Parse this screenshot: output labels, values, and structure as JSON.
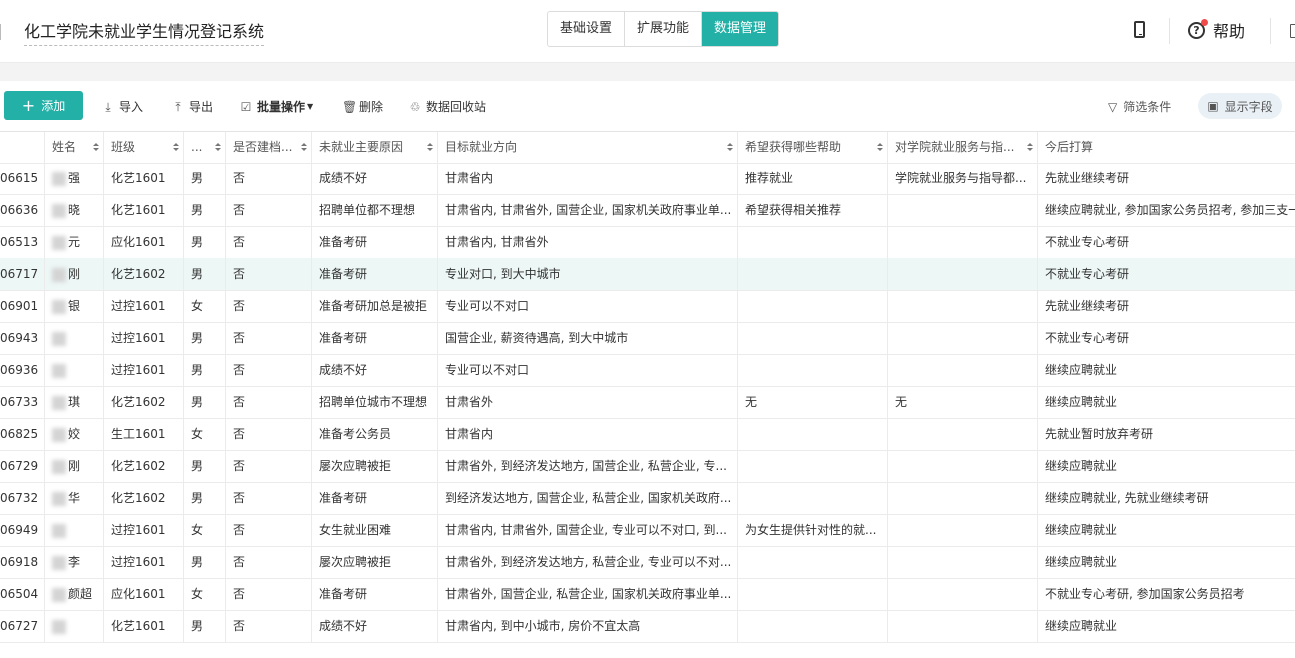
{
  "app": {
    "title": "化工学院未就业学生情况登记系统"
  },
  "nav": {
    "tabs": [
      "基础设置",
      "扩展功能",
      "数据管理"
    ],
    "active": "数据管理"
  },
  "header_actions": {
    "help_label": "帮助"
  },
  "toolbar": {
    "add_label": "添加",
    "import_label": "导入",
    "export_label": "导出",
    "batch_label": "批量操作",
    "delete_label": "删除",
    "recycle_label": "数据回收站",
    "filter_label": "筛选条件",
    "fields_label": "显示字段"
  },
  "table": {
    "headers": [
      "",
      "姓名",
      "班级",
      "...",
      "是否建档...",
      "未就业主要原因",
      "目标就业方向",
      "希望获得哪些帮助",
      "对学院就业服务与指...",
      "今后打算"
    ],
    "rows": [
      [
        "06615",
        "强",
        "化艺1601",
        "男",
        "否",
        "成绩不好",
        "甘肃省内",
        "推荐就业",
        "学院就业服务与指导都...",
        "先就业继续考研"
      ],
      [
        "06636",
        "晓",
        "化艺1601",
        "男",
        "否",
        "招聘单位都不理想",
        "甘肃省内, 甘肃省外, 国营企业, 国家机关政府事业单...",
        "希望获得相关推荐",
        "",
        "继续应聘就业, 参加国家公务员招考, 参加三支一扶"
      ],
      [
        "06513",
        "元",
        "应化1601",
        "男",
        "否",
        "准备考研",
        "甘肃省内, 甘肃省外",
        "",
        "",
        "不就业专心考研"
      ],
      [
        "06717",
        "刚",
        "化艺1602",
        "男",
        "否",
        "准备考研",
        "专业对口, 到大中城市",
        "",
        "",
        "不就业专心考研"
      ],
      [
        "06901",
        "银",
        "过控1601",
        "女",
        "否",
        "准备考研加总是被拒",
        "专业可以不对口",
        "",
        "",
        "先就业继续考研"
      ],
      [
        "06943",
        "",
        "过控1601",
        "男",
        "否",
        "准备考研",
        "国营企业, 薪资待遇高, 到大中城市",
        "",
        "",
        "不就业专心考研"
      ],
      [
        "06936",
        "",
        "过控1601",
        "男",
        "否",
        "成绩不好",
        "专业可以不对口",
        "",
        "",
        "继续应聘就业"
      ],
      [
        "06733",
        "琪",
        "化艺1602",
        "男",
        "否",
        "招聘单位城市不理想",
        "甘肃省外",
        "无",
        "无",
        "继续应聘就业"
      ],
      [
        "06825",
        "姣",
        "生工1601",
        "女",
        "否",
        "准备考公务员",
        "甘肃省内",
        "",
        "",
        "先就业暂时放弃考研"
      ],
      [
        "06729",
        "刚",
        "化艺1602",
        "男",
        "否",
        "屡次应聘被拒",
        "甘肃省外, 到经济发达地方, 国营企业, 私营企业, 专...",
        "",
        "",
        "继续应聘就业"
      ],
      [
        "06732",
        "华",
        "化艺1602",
        "男",
        "否",
        "准备考研",
        "到经济发达地方, 国营企业, 私营企业, 国家机关政府...",
        "",
        "",
        "继续应聘就业, 先就业继续考研"
      ],
      [
        "06949",
        "",
        "过控1601",
        "女",
        "否",
        "女生就业困难",
        "甘肃省内, 甘肃省外, 国营企业, 专业可以不对口, 到...",
        "为女生提供针对性的就...",
        "",
        "继续应聘就业"
      ],
      [
        "06918",
        "李",
        "过控1601",
        "男",
        "否",
        "屡次应聘被拒",
        "甘肃省外, 到经济发达地方, 私营企业, 专业可以不对...",
        "",
        "",
        "继续应聘就业"
      ],
      [
        "06504",
        "颜超",
        "应化1601",
        "女",
        "否",
        "准备考研",
        "甘肃省外, 国营企业, 私营企业, 国家机关政府事业单...",
        "",
        "",
        "不就业专心考研, 参加国家公务员招考"
      ],
      [
        "06727",
        "",
        "化艺1601",
        "男",
        "否",
        "成绩不好",
        "甘肃省内, 到中小城市, 房价不宜太高",
        "",
        "",
        "继续应聘就业"
      ]
    ],
    "hover_row_index": 3
  }
}
